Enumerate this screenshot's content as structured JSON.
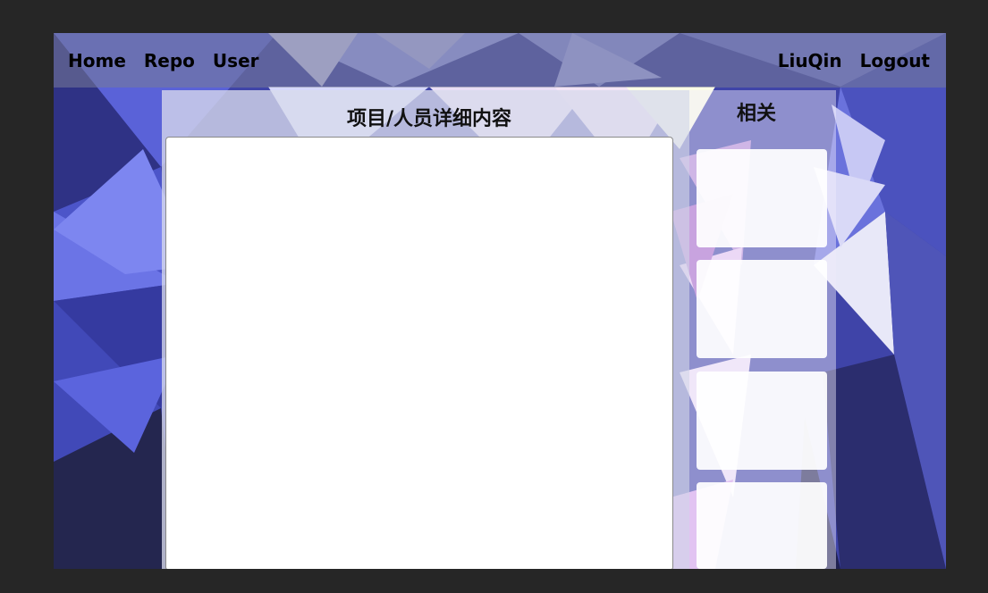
{
  "nav": {
    "left_links": [
      {
        "label": "Home"
      },
      {
        "label": "Repo"
      },
      {
        "label": "User"
      }
    ],
    "right_links": [
      {
        "label": "LiuQin"
      },
      {
        "label": "Logout"
      }
    ]
  },
  "main": {
    "title": "项目/人员详细内容",
    "content": ""
  },
  "sidebar": {
    "title": "相关",
    "cards": [
      {
        "text": ""
      },
      {
        "text": ""
      },
      {
        "text": ""
      },
      {
        "text": ""
      }
    ]
  },
  "colors": {
    "page_background": "#262626",
    "navbar_background": "#787c96",
    "panel_background": "#d7daec",
    "theme_dark_blue": "#2b2d6e",
    "theme_blue": "#4a52c6",
    "theme_light_purple": "#c7c3f0"
  }
}
